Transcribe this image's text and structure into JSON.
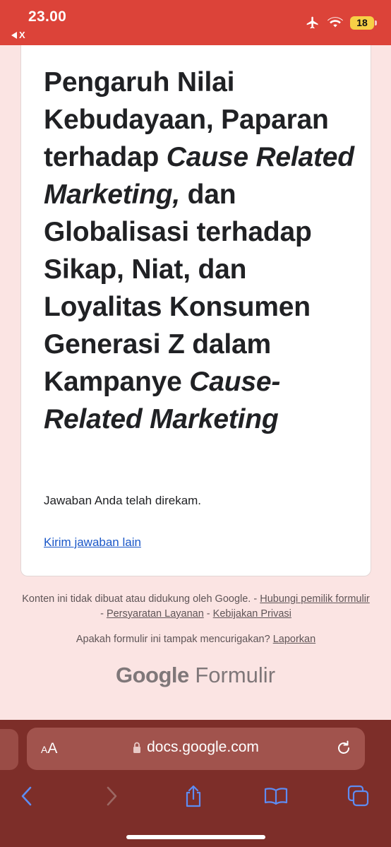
{
  "status_bar": {
    "time": "23.00",
    "back_label": "X",
    "battery": "18"
  },
  "form": {
    "title_parts": [
      {
        "text": "Pengaruh Nilai Kebudayaan, Paparan terhadap ",
        "italic": false
      },
      {
        "text": "Cause Related Marketing,",
        "italic": true
      },
      {
        "text": " dan Globalisasi terhadap Sikap, Niat, dan Loyalitas Konsumen Generasi Z dalam Kampanye ",
        "italic": false
      },
      {
        "text": "Cause-Related Marketing",
        "italic": true
      }
    ],
    "response_recorded": "Jawaban Anda telah direkam.",
    "submit_another_link": "Kirim jawaban lain"
  },
  "footer": {
    "disclaimer": "Konten ini tidak dibuat atau didukung oleh Google. -",
    "contact_owner_link": "Hubungi pemilik formulir",
    "sep1": " - ",
    "terms_link": "Persyaratan Layanan",
    "sep2": " - ",
    "privacy_link": "Kebijakan Privasi",
    "suspicious_question": "Apakah formulir ini tampak mencurigakan?",
    "report_link": "Laporkan",
    "brand_google": "Google",
    "brand_forms": "Formulir"
  },
  "browser": {
    "text_size_small": "A",
    "text_size_large": "A",
    "url": "docs.google.com"
  },
  "colors": {
    "status_bar": "#dc4339",
    "page_background": "#fbe4e3",
    "link": "#1a57c8",
    "browser_chrome": "#7d2e29"
  }
}
